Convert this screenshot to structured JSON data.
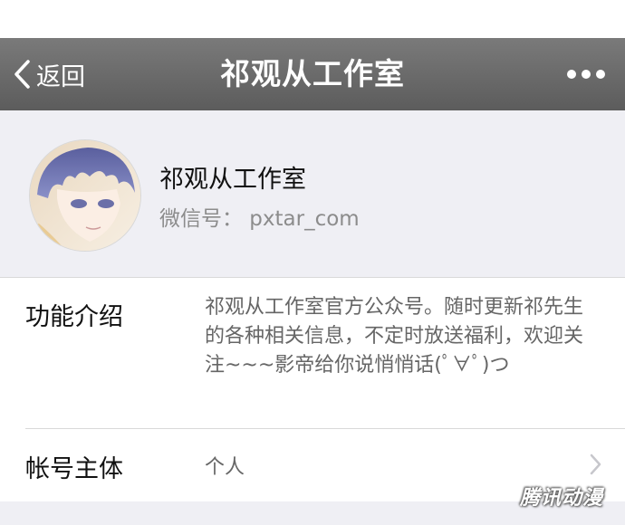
{
  "navbar": {
    "back_label": "返回",
    "title": "祁观从工作室",
    "more_icon": "more-dots-icon"
  },
  "profile": {
    "name": "祁观从工作室",
    "wechat_id": "微信号：  pxtar_com",
    "avatar_icon": "avatar"
  },
  "details": {
    "intro_label": "功能介绍",
    "intro_text": "祁观从工作室官方公众号。随时更新祁先生的各种相关信息，不定时放送福利，欢迎关注~~~影帝给你说悄悄话(ﾟ∀ﾟ)つ",
    "account_label": "帐号主体",
    "account_value": "个人"
  },
  "watermark": {
    "text": "腾讯动漫"
  },
  "colors": {
    "navbar": "#5c5c5c",
    "page_background": "#efeff4",
    "primary_text": "#111111",
    "secondary_text": "#666666"
  }
}
